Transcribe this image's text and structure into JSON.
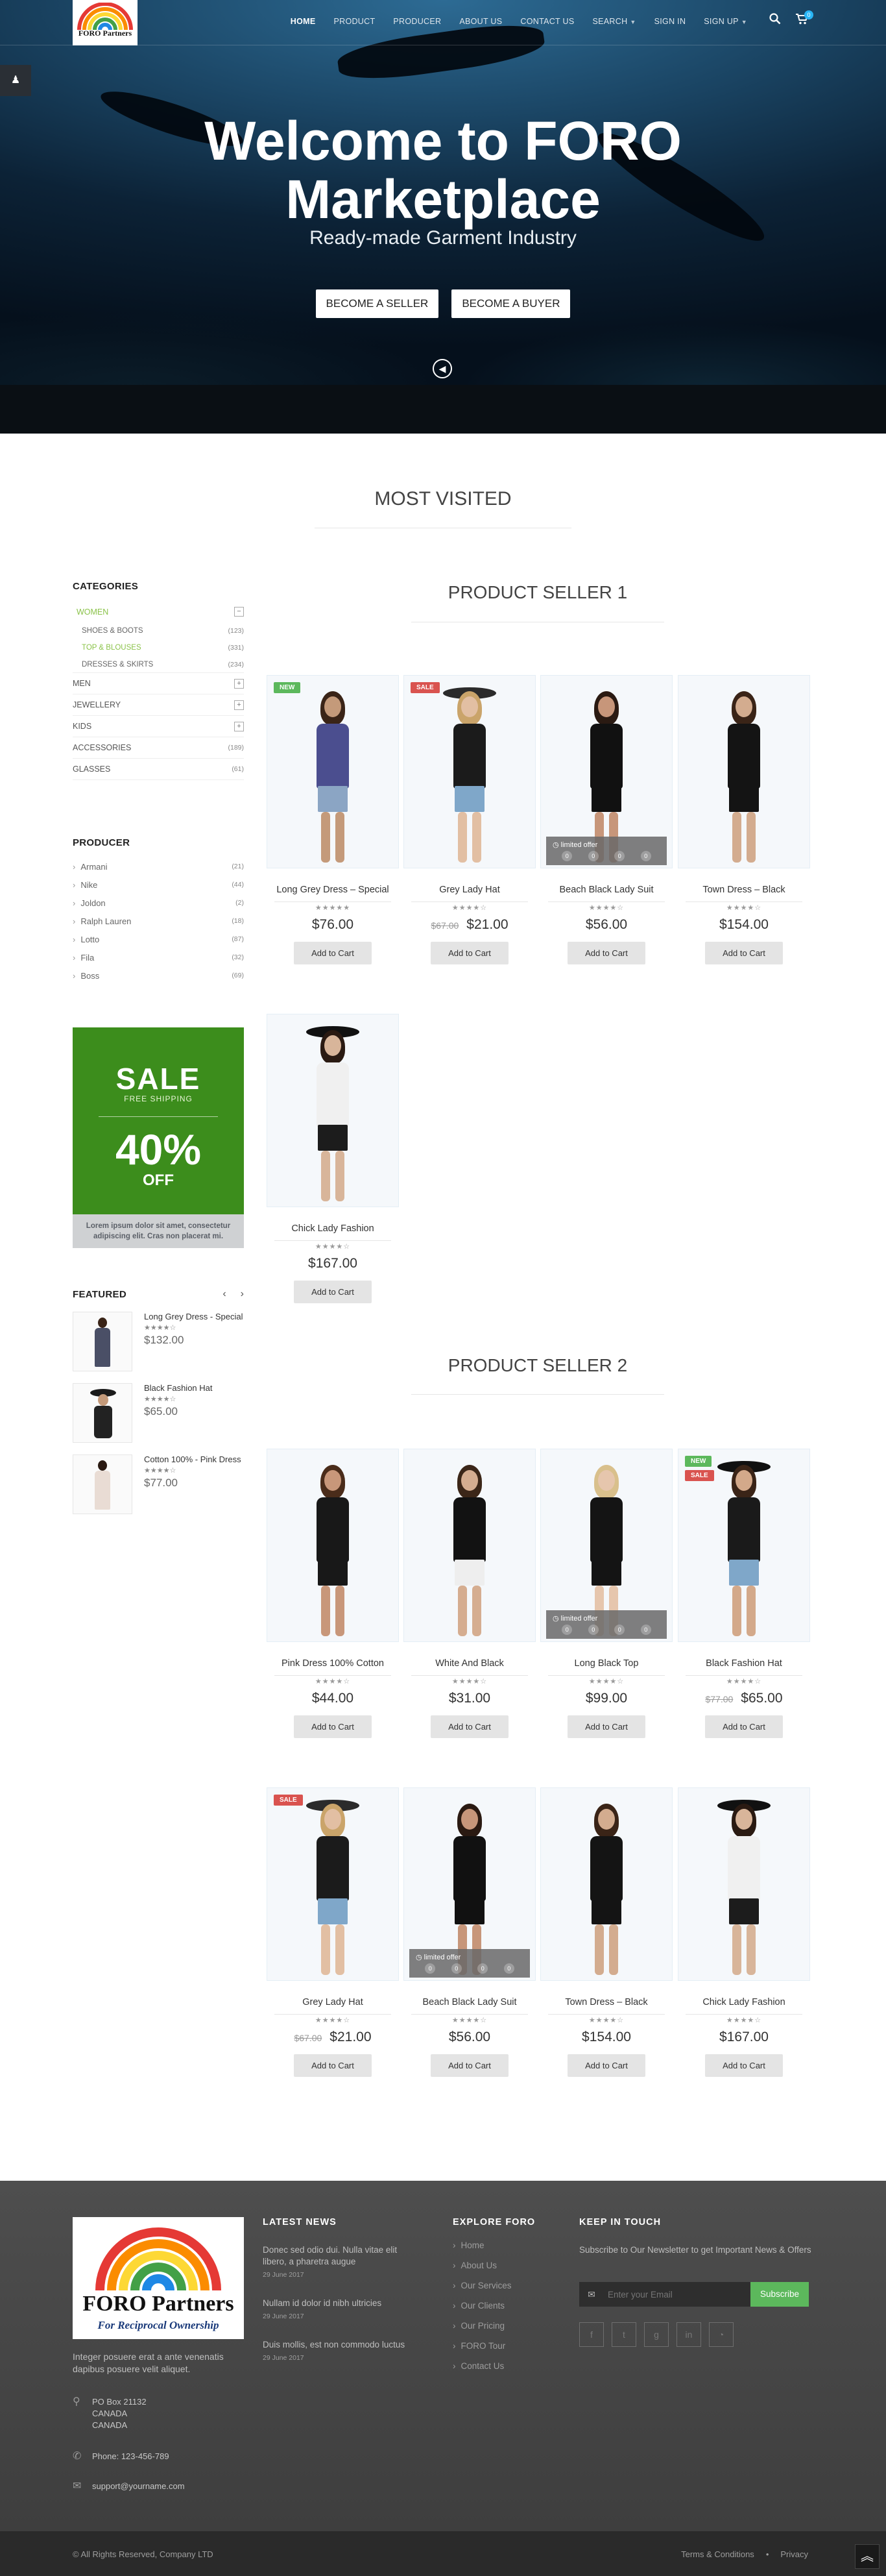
{
  "logo": {
    "text": "FORO Partners"
  },
  "nav": {
    "items": [
      {
        "label": "HOME",
        "active": true
      },
      {
        "label": "PRODUCT"
      },
      {
        "label": "PRODUCER"
      },
      {
        "label": "ABOUT US"
      },
      {
        "label": "CONTACT US"
      },
      {
        "label": "SEARCH",
        "caret": true
      },
      {
        "label": "SIGN IN"
      },
      {
        "label": "SIGN UP",
        "caret": true
      }
    ],
    "cart_count": "0"
  },
  "hero": {
    "title_line1": "Welcome to FORO",
    "title_line2": "Marketplace",
    "subtitle": "Ready-made Garment Industry",
    "btn_seller": "BECOME A SELLER",
    "btn_buyer": "BECOME A BUYER"
  },
  "most_visited": "MOST VISITED",
  "categories": {
    "title": "CATEGORIES",
    "items": [
      {
        "label": "WOMEN",
        "active": true,
        "expanded": true,
        "sub": [
          {
            "label": "SHOES & BOOTS",
            "count": "(123)"
          },
          {
            "label": "TOP & BLOUSES",
            "count": "(331)",
            "active": true
          },
          {
            "label": "DRESSES & SKIRTS",
            "count": "(234)"
          }
        ]
      },
      {
        "label": "MEN",
        "icon": "+"
      },
      {
        "label": "JEWELLERY",
        "icon": "+"
      },
      {
        "label": "KIDS",
        "icon": "+"
      },
      {
        "label": "ACCESSORIES",
        "count": "(189)"
      },
      {
        "label": "GLASSES",
        "count": "(61)"
      }
    ]
  },
  "producer": {
    "title": "PRODUCER",
    "items": [
      {
        "label": "Armani",
        "count": "(21)"
      },
      {
        "label": "Nike",
        "count": "(44)"
      },
      {
        "label": "Joldon",
        "count": "(2)"
      },
      {
        "label": "Ralph Lauren",
        "count": "(18)"
      },
      {
        "label": "Lotto",
        "count": "(87)"
      },
      {
        "label": "Fila",
        "count": "(32)"
      },
      {
        "label": "Boss",
        "count": "(69)"
      }
    ]
  },
  "sale_banner": {
    "sale": "SALE",
    "free_shipping": "FREE SHIPPING",
    "percent": "40%",
    "off": "OFF",
    "caption": "Lorem ipsum dolor sit amet, consectetur adipiscing elit. Cras non placerat mi."
  },
  "featured": {
    "title": "FEATURED",
    "items": [
      {
        "name": "Long Grey Dress - Special",
        "stars": "★★★★☆",
        "price": "$132.00"
      },
      {
        "name": "Black Fashion Hat",
        "stars": "★★★★☆",
        "price": "$65.00"
      },
      {
        "name": "Cotton 100% - Pink Dress",
        "stars": "★★★★☆",
        "price": "$77.00"
      }
    ]
  },
  "seller1": {
    "title": "PRODUCT SELLER 1",
    "products": [
      {
        "name": "Long Grey Dress – Special",
        "stars": "★★★★★",
        "price": "$76.00",
        "badge": "NEW"
      },
      {
        "name": "Grey Lady Hat",
        "stars": "★★★★☆",
        "old_price": "$67.00",
        "price": "$21.00",
        "badge": "SALE"
      },
      {
        "name": "Beach Black Lady Suit",
        "stars": "★★★★☆",
        "price": "$56.00",
        "limited": true
      },
      {
        "name": "Town Dress – Black",
        "stars": "★★★★☆",
        "price": "$154.00"
      },
      {
        "name": "Chick Lady Fashion",
        "stars": "★★★★☆",
        "price": "$167.00"
      }
    ]
  },
  "seller2": {
    "title": "PRODUCT SELLER 2",
    "products": [
      {
        "name": "Pink Dress 100% Cotton",
        "stars": "★★★★☆",
        "price": "$44.00"
      },
      {
        "name": "White And Black",
        "stars": "★★★★☆",
        "price": "$31.00"
      },
      {
        "name": "Long Black Top",
        "stars": "★★★★☆",
        "price": "$99.00",
        "limited": true
      },
      {
        "name": "Black Fashion Hat",
        "stars": "★★★★☆",
        "old_price": "$77.00",
        "price": "$65.00",
        "badge": "NEW",
        "badge2": "SALE"
      },
      {
        "name": "Grey Lady Hat",
        "stars": "★★★★☆",
        "old_price": "$67.00",
        "price": "$21.00",
        "badge": "SALE"
      },
      {
        "name": "Beach Black Lady Suit",
        "stars": "★★★★☆",
        "price": "$56.00",
        "limited": true
      },
      {
        "name": "Town Dress – Black",
        "stars": "★★★★☆",
        "price": "$154.00"
      },
      {
        "name": "Chick Lady Fashion",
        "stars": "★★★★☆",
        "price": "$167.00"
      }
    ]
  },
  "add_to_cart": "Add to Cart",
  "limited_offer": "limited offer",
  "footer": {
    "logo_line1": "FORO Partners",
    "logo_line2": "For Reciprocal Ownership",
    "description": "Integer posuere erat a ante venenatis dapibus posuere velit aliquet.",
    "address": [
      "PO Box 21132",
      "CANADA",
      "CANADA"
    ],
    "phone": "Phone: 123-456-789",
    "email": "support@yourname.com",
    "news_title": "LATEST NEWS",
    "news": [
      {
        "text": "Donec sed odio dui. Nulla vitae elit libero, a pharetra augue",
        "date": "29 June 2017"
      },
      {
        "text": "Nullam id dolor id nibh ultricies",
        "date": "29 June 2017"
      },
      {
        "text": "Duis mollis, est non commodo luctus",
        "date": "29 June 2017"
      }
    ],
    "explore_title": "EXPLORE FORO",
    "explore_links": [
      "Home",
      "About Us",
      "Our Services",
      "Our Clients",
      "Our Pricing",
      "FORO Tour",
      "Contact Us"
    ],
    "keep_title": "KEEP IN TOUCH",
    "newsletter_text": "Subscribe to Our Newsletter to get Important News & Offers",
    "email_placeholder": "Enter your Email",
    "subscribe": "Subscribe",
    "copyright": "© All Rights Reserved, Company LTD",
    "terms": "Terms & Conditions",
    "privacy": "Privacy"
  }
}
